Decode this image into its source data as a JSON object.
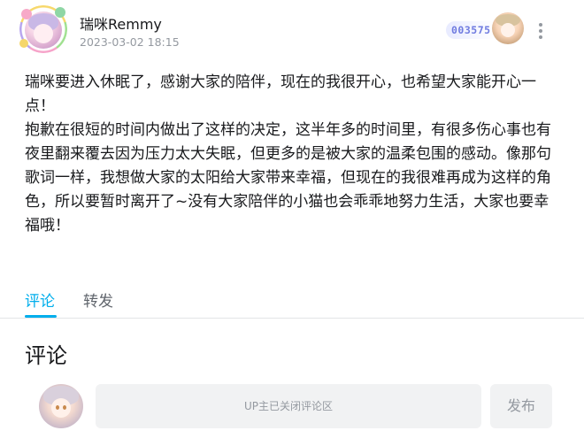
{
  "post": {
    "author": {
      "name": "瑞咪Remmy",
      "timestamp": "2023-03-02 18:15",
      "fan_badge_number": "003575"
    },
    "content_lines": [
      "瑞咪要进入休眠了，感谢大家的陪伴，现在的我很开心，也希望大家能开心一点！",
      "抱歉在很短的时间内做出了这样的决定，这半年多的时间里，有很多伤心事也有夜里翻来覆去因为压力太大失眠，但更多的是被大家的温柔包围的感动。像那句歌词一样，我想做大家的太阳给大家带来幸福，但现在的我很难再成为这样的角色，所以要暂时离开了~没有大家陪伴的小猫也会乖乖地努力生活，大家也要幸福哦！"
    ]
  },
  "tabs": {
    "comments": "评论",
    "reposts": "转发"
  },
  "comments_section": {
    "heading": "评论",
    "input_placeholder": "UP主已关闭评论区",
    "publish_label": "发布"
  },
  "colors": {
    "accent": "#00aeec",
    "text_primary": "#18191c",
    "text_secondary": "#9499a0",
    "input_bg": "#f1f2f3",
    "fan_badge": "#6f7be0"
  },
  "icons": {
    "more": "more-vertical-icon"
  }
}
